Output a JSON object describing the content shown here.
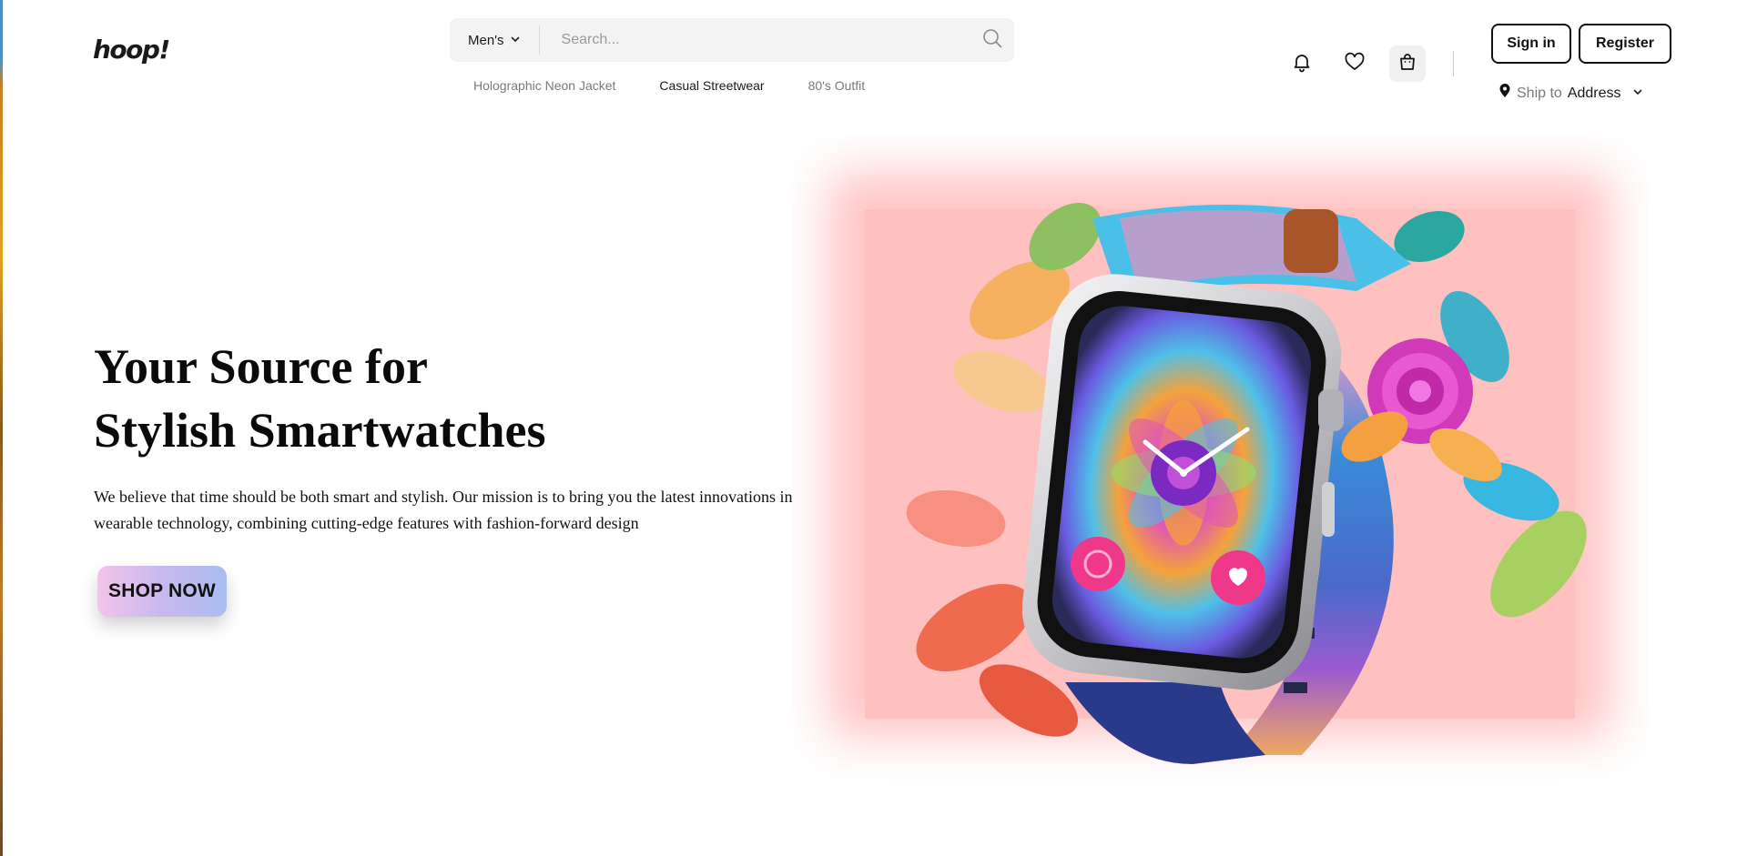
{
  "header": {
    "logo": "hoop!",
    "search": {
      "category": "Men's",
      "placeholder": "Search..."
    },
    "suggestions": [
      "Holographic Neon Jacket",
      "Casual Streetwear",
      "80's Outfit"
    ],
    "active_suggestion": "Casual Streetwear",
    "sign_in_label": "Sign in",
    "register_label": "Register",
    "ship_to": {
      "label": "Ship to",
      "address": "Address"
    },
    "icons": [
      "bell-icon",
      "heart-icon",
      "bag-icon",
      "search-icon",
      "location-pin-icon",
      "chevron-down-icon"
    ]
  },
  "hero": {
    "title_line1": "Your Source for",
    "title_line2": "Stylish Smartwatches",
    "description": "We believe that time should be both smart and stylish. Our mission is to bring you the latest innovations in wearable technology, combining cutting-edge features with fashion-forward design",
    "cta_label": "SHOP NOW",
    "image_bg_color": "#ffc4c4"
  },
  "colors": {
    "text": "#111111",
    "search_bg": "#f3f3f4",
    "muted": "#7a7a7e",
    "cta_gradient": [
      "#f3c4ea",
      "#a9bdf0"
    ]
  }
}
